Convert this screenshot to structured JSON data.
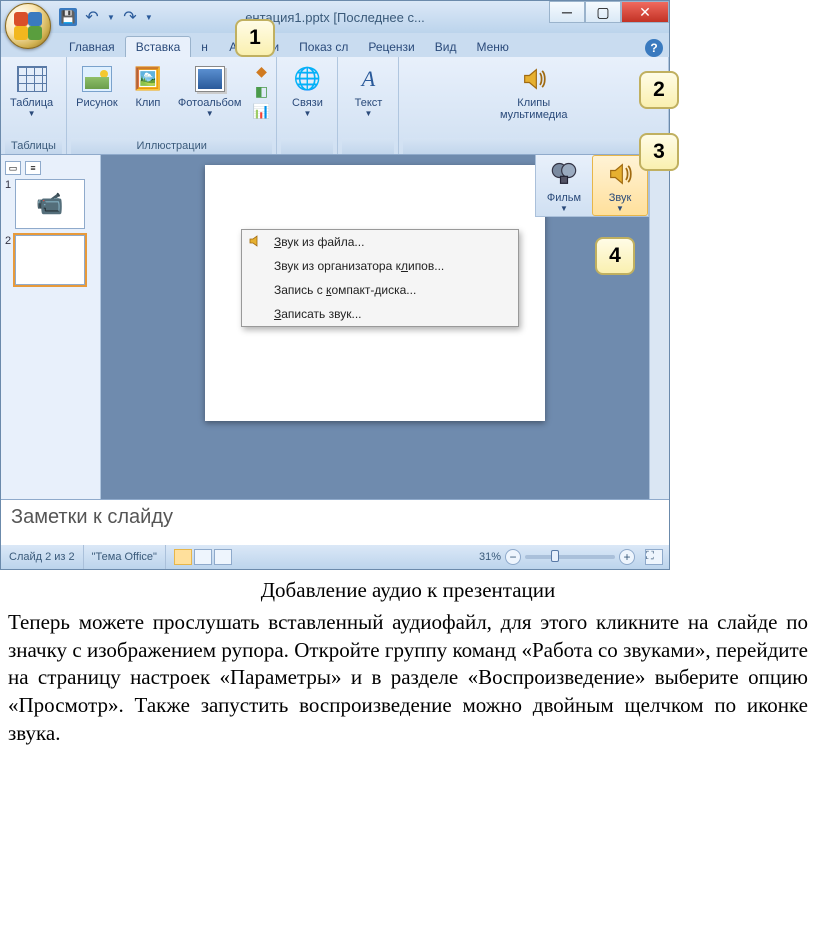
{
  "title": "ентация1.pptx [Последнее с...",
  "tabs": {
    "home": "Главная",
    "insert": "Вставка",
    "design_cut": "н",
    "anim": "Анимаци",
    "show": "Показ сл",
    "review": "Рецензи",
    "view": "Вид",
    "menu": "Меню"
  },
  "ribbon": {
    "tables_group": "Таблицы",
    "table": "Таблица",
    "illus_group": "Иллюстрации",
    "pic": "Рисунок",
    "clip": "Клип",
    "album": "Фотоальбом",
    "links": "Связи",
    "text": "Текст",
    "media_group": "Клипы\nмультимедиа",
    "film": "Фильм",
    "sound": "Звук"
  },
  "dropdown": {
    "from_file1": "З",
    "from_file2": "вук из файла...",
    "from_org1": "Звук из организатора к",
    "from_org_u": "л",
    "from_org2": "ипов...",
    "cd1": "Запись с ",
    "cd_u": "к",
    "cd2": "омпакт-диска...",
    "rec_u": "З",
    "rec2": "аписать звук..."
  },
  "thumbs": {
    "n1": "1",
    "n2": "2"
  },
  "notes": "Заметки к слайду",
  "status": {
    "slide": "Слайд 2 из 2",
    "theme": "\"Тема Office\"",
    "zoom": "31%"
  },
  "callouts": {
    "c1": "1",
    "c2": "2",
    "c3": "3",
    "c4": "4"
  },
  "caption": "Добавление аудио к презентации",
  "body": "Теперь можете прослушать вставленный аудиофайл, для этого кликните на слайде по значку с изображением рупора. Откройте группу команд «Работа со звуками», перейдите на страницу настроек «Параметры» и в разделе «Воспроизведение» выберите опцию «Просмотр». Также запустить воспроизведение можно двойным щелчком по иконке звука."
}
